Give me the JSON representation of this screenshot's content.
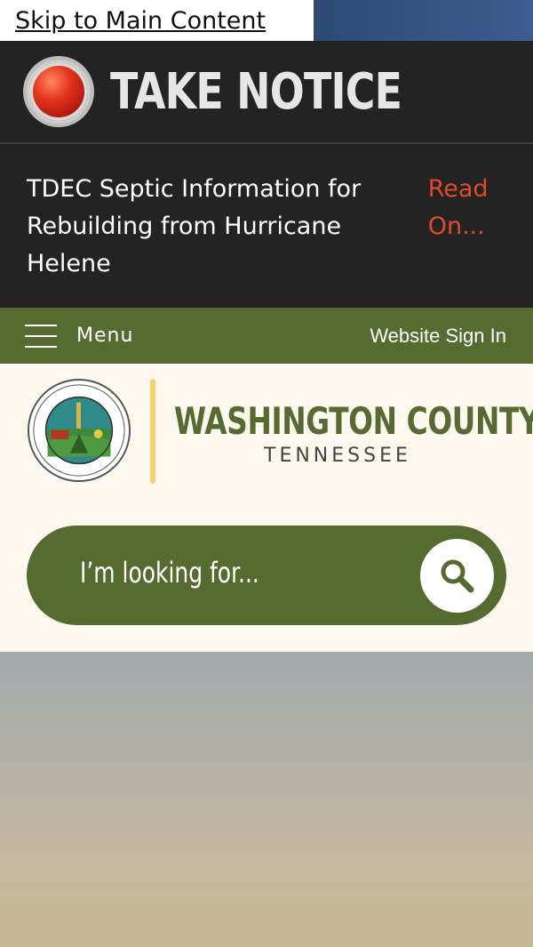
{
  "skip_link": "Skip to Main Content",
  "notice": {
    "title": "TAKE NOTICE",
    "message": "TDEC Septic Information for Rebuilding from Hurricane Helene",
    "link": "Read On..."
  },
  "menubar": {
    "menu_label": "Menu",
    "sign_in": "Website Sign In"
  },
  "header": {
    "county": "WASHINGTON COUNTY",
    "state": "TENNESSEE"
  },
  "search": {
    "placeholder": "I’m looking for..."
  },
  "colors": {
    "brand_green": "#556b30",
    "accent_yellow": "#f5d46a",
    "alert_red": "#e1492a",
    "notice_bg": "#232323"
  }
}
